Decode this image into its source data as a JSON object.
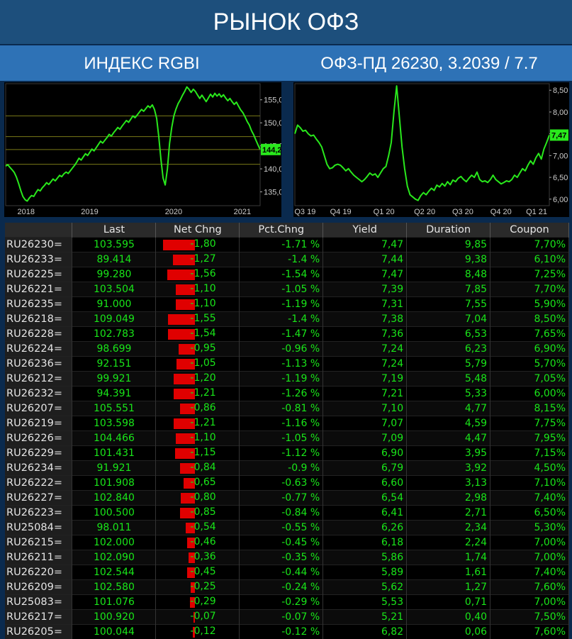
{
  "header": {
    "title": "РЫНОК ОФЗ"
  },
  "subheader": {
    "left": "ИНДЕКС RGBI",
    "right": "ОФЗ-ПД 26230, 3.2039 / 7.7"
  },
  "colors": {
    "line": "#29e81c",
    "bar": "#e00000",
    "text_green": "#19e619",
    "title_bg": "#1d4f7c",
    "sub_bg": "#2e72b6"
  },
  "chart_data": [
    {
      "type": "line",
      "x_labels": [
        "2018",
        "2019",
        "2020",
        "2021"
      ],
      "y_ticks": [
        "155,0",
        "150,0",
        "145,0",
        "140,0",
        "135,0"
      ],
      "ylim": [
        132,
        158.5
      ],
      "last_value_label": "144,2",
      "x": [
        0,
        1,
        2,
        3,
        4,
        5,
        6,
        7,
        8,
        9,
        10,
        11,
        12,
        13,
        14,
        15,
        16,
        17,
        18,
        19,
        20,
        21,
        22,
        23,
        24,
        25,
        26,
        27,
        28,
        29,
        30,
        31,
        32,
        33,
        34,
        35,
        36,
        37,
        38,
        39,
        40,
        41,
        42,
        43,
        44,
        45,
        46,
        47,
        48,
        49,
        50,
        51,
        52,
        53,
        54,
        55,
        56,
        57,
        58,
        59,
        60,
        61,
        62,
        63,
        64,
        65,
        66,
        67,
        68,
        69,
        70,
        71,
        72,
        73,
        74,
        75,
        76,
        77,
        78,
        79,
        80,
        81,
        82,
        83,
        84,
        85,
        86,
        87,
        88,
        89,
        90,
        91,
        92,
        93,
        94,
        95,
        96,
        97,
        98,
        99,
        100,
        101,
        102,
        103,
        104,
        105,
        106,
        107,
        108,
        109,
        110,
        111,
        112,
        113,
        114,
        115,
        116,
        117,
        118,
        119,
        120,
        121,
        122,
        123,
        124,
        125,
        126,
        127,
        128,
        129,
        130,
        131,
        132,
        133,
        134,
        135,
        136,
        137,
        138,
        139,
        140,
        141,
        142,
        143,
        144,
        145,
        146,
        147,
        148,
        149,
        150,
        151,
        152,
        153,
        154,
        155,
        156,
        157,
        158,
        159,
        160,
        161,
        162,
        163,
        164,
        165,
        166,
        167,
        168,
        169,
        170,
        171,
        172,
        173,
        174,
        175,
        176,
        177,
        178,
        179,
        180,
        181,
        182,
        183,
        184,
        185,
        186,
        187,
        188,
        189,
        190,
        191,
        192,
        193,
        194,
        195,
        196,
        197,
        198,
        199,
        200
      ],
      "values": [
        140.6,
        140.9,
        140.3,
        139.8,
        139.2,
        138.2,
        136.8,
        135.3,
        134.0,
        133.3,
        133.0,
        133.7,
        134.2,
        134.0,
        134.8,
        135.5,
        135.2,
        135.9,
        136.4,
        137.0,
        136.6,
        137.2,
        137.8,
        137.4,
        138.0,
        138.6,
        138.3,
        138.9,
        139.3,
        139.0,
        139.6,
        140.2,
        140.8,
        141.5,
        142.3,
        141.9,
        142.6,
        143.3,
        142.9,
        143.6,
        144.3,
        143.9,
        144.6,
        145.3,
        146.0,
        145.6,
        146.2,
        146.8,
        147.5,
        147.1,
        147.8,
        148.4,
        149.0,
        148.6,
        149.3,
        149.9,
        150.5,
        150.1,
        150.8,
        151.5,
        151.1,
        151.7,
        152.3,
        152.9,
        152.5,
        153.1,
        153.7,
        153.3,
        153.9,
        152.9,
        151.0,
        147.0,
        142.0,
        138.0,
        136.5,
        140.0,
        145.5,
        149.0,
        151.5,
        153.0,
        154.2,
        155.0,
        156.0,
        156.8,
        157.8,
        157.3,
        156.6,
        157.3,
        156.8,
        156.0,
        155.3,
        156.0,
        155.3,
        154.6,
        155.4,
        156.2,
        155.6,
        156.4,
        155.8,
        156.3,
        155.6,
        156.1,
        155.4,
        154.8,
        155.3,
        154.6,
        154.0,
        154.5,
        153.6,
        152.8,
        152.2,
        151.3,
        150.3,
        149.5,
        148.3,
        147.4,
        146.3,
        145.2,
        144.2
      ]
    },
    {
      "type": "line",
      "x_labels": [
        "Q3 19",
        "Q4 19",
        "Q1 20",
        "Q2 20",
        "Q3 20",
        "Q4 20",
        "Q1 21"
      ],
      "y_ticks": [
        "8,50",
        "8,00",
        "7,50",
        "7,00",
        "6,50",
        "6,00"
      ],
      "ylim": [
        5.85,
        8.65
      ],
      "last_value_label": "7,47",
      "values": [
        7.5,
        7.7,
        7.64,
        7.56,
        7.58,
        7.5,
        7.45,
        7.47,
        7.38,
        7.3,
        7.2,
        7.0,
        6.8,
        6.7,
        6.72,
        6.78,
        6.8,
        6.78,
        6.72,
        6.65,
        6.7,
        6.62,
        6.55,
        6.5,
        6.45,
        6.4,
        6.45,
        6.52,
        6.6,
        6.55,
        6.58,
        6.5,
        6.6,
        6.7,
        6.75,
        7.0,
        7.3,
        8.0,
        8.6,
        7.9,
        7.2,
        6.7,
        6.3,
        6.1,
        6.05,
        6.0,
        5.97,
        6.08,
        6.15,
        6.1,
        6.18,
        6.25,
        6.2,
        6.32,
        6.28,
        6.36,
        6.3,
        6.4,
        6.33,
        6.44,
        6.4,
        6.48,
        6.52,
        6.45,
        6.4,
        6.48,
        6.55,
        6.5,
        6.62,
        6.45,
        6.4,
        6.42,
        6.38,
        6.45,
        6.55,
        6.45,
        6.4,
        6.35,
        6.38,
        6.42,
        6.4,
        6.45,
        6.55,
        6.5,
        6.6,
        6.7,
        6.65,
        6.78,
        6.88,
        6.8,
        6.95,
        7.05,
        6.92,
        7.15,
        7.3,
        7.47
      ]
    },
    {
      "type": "table",
      "columns": [
        "",
        "Last",
        "Net Chng",
        "Pct.Chng",
        "Yield",
        "Duration",
        "Coupon"
      ],
      "rows": [
        {
          "ric": "RU26230=",
          "last": "103.595",
          "chg": "-1,80",
          "chg_value": -1.8,
          "pct": "-1.71 %",
          "yield": "7,47",
          "duration": "9,85",
          "coupon": "7,70%"
        },
        {
          "ric": "RU26233=",
          "last": "89.414",
          "chg": "-1,27",
          "chg_value": -1.27,
          "pct": "-1.4 %",
          "yield": "7,44",
          "duration": "9,38",
          "coupon": "6,10%"
        },
        {
          "ric": "RU26225=",
          "last": "99.280",
          "chg": "-1,56",
          "chg_value": -1.56,
          "pct": "-1.54 %",
          "yield": "7,47",
          "duration": "8,48",
          "coupon": "7,25%"
        },
        {
          "ric": "RU26221=",
          "last": "103.504",
          "chg": "-1,10",
          "chg_value": -1.1,
          "pct": "-1.05 %",
          "yield": "7,39",
          "duration": "7,85",
          "coupon": "7,70%"
        },
        {
          "ric": "RU26235=",
          "last": "91.000",
          "chg": "-1,10",
          "chg_value": -1.1,
          "pct": "-1.19 %",
          "yield": "7,31",
          "duration": "7,55",
          "coupon": "5,90%"
        },
        {
          "ric": "RU26218=",
          "last": "109.049",
          "chg": "-1,55",
          "chg_value": -1.55,
          "pct": "-1.4 %",
          "yield": "7,38",
          "duration": "7,04",
          "coupon": "8,50%"
        },
        {
          "ric": "RU26228=",
          "last": "102.783",
          "chg": "-1,54",
          "chg_value": -1.54,
          "pct": "-1.47 %",
          "yield": "7,36",
          "duration": "6,53",
          "coupon": "7,65%"
        },
        {
          "ric": "RU26224=",
          "last": "98.699",
          "chg": "-0,95",
          "chg_value": -0.95,
          "pct": "-0.96 %",
          "yield": "7,24",
          "duration": "6,23",
          "coupon": "6,90%"
        },
        {
          "ric": "RU26236=",
          "last": "92.151",
          "chg": "-1,05",
          "chg_value": -1.05,
          "pct": "-1.13 %",
          "yield": "7,24",
          "duration": "5,79",
          "coupon": "5,70%"
        },
        {
          "ric": "RU26212=",
          "last": "99.921",
          "chg": "-1,20",
          "chg_value": -1.2,
          "pct": "-1.19 %",
          "yield": "7,19",
          "duration": "5,48",
          "coupon": "7,05%"
        },
        {
          "ric": "RU26232=",
          "last": "94.391",
          "chg": "-1,21",
          "chg_value": -1.21,
          "pct": "-1.26 %",
          "yield": "7,21",
          "duration": "5,33",
          "coupon": "6,00%"
        },
        {
          "ric": "RU26207=",
          "last": "105.551",
          "chg": "-0,86",
          "chg_value": -0.86,
          "pct": "-0.81 %",
          "yield": "7,10",
          "duration": "4,77",
          "coupon": "8,15%"
        },
        {
          "ric": "RU26219=",
          "last": "103.598",
          "chg": "-1,21",
          "chg_value": -1.21,
          "pct": "-1.16 %",
          "yield": "7,07",
          "duration": "4,59",
          "coupon": "7,75%"
        },
        {
          "ric": "RU26226=",
          "last": "104.466",
          "chg": "-1,10",
          "chg_value": -1.1,
          "pct": "-1.05 %",
          "yield": "7,09",
          "duration": "4,47",
          "coupon": "7,95%"
        },
        {
          "ric": "RU26229=",
          "last": "101.431",
          "chg": "-1,15",
          "chg_value": -1.15,
          "pct": "-1.12 %",
          "yield": "6,90",
          "duration": "3,95",
          "coupon": "7,15%"
        },
        {
          "ric": "RU26234=",
          "last": "91.921",
          "chg": "-0,84",
          "chg_value": -0.84,
          "pct": "-0.9 %",
          "yield": "6,79",
          "duration": "3,92",
          "coupon": "4,50%"
        },
        {
          "ric": "RU26222=",
          "last": "101.908",
          "chg": "-0,65",
          "chg_value": -0.65,
          "pct": "-0.63 %",
          "yield": "6,60",
          "duration": "3,13",
          "coupon": "7,10%"
        },
        {
          "ric": "RU26227=",
          "last": "102.840",
          "chg": "-0,80",
          "chg_value": -0.8,
          "pct": "-0.77 %",
          "yield": "6,54",
          "duration": "2,98",
          "coupon": "7,40%"
        },
        {
          "ric": "RU26223=",
          "last": "100.500",
          "chg": "-0,85",
          "chg_value": -0.85,
          "pct": "-0.84 %",
          "yield": "6,41",
          "duration": "2,71",
          "coupon": "6,50%"
        },
        {
          "ric": "RU25084=",
          "last": "98.011",
          "chg": "-0,54",
          "chg_value": -0.54,
          "pct": "-0.55 %",
          "yield": "6,26",
          "duration": "2,34",
          "coupon": "5,30%"
        },
        {
          "ric": "RU26215=",
          "last": "102.000",
          "chg": "-0,46",
          "chg_value": -0.46,
          "pct": "-0.45 %",
          "yield": "6,18",
          "duration": "2,24",
          "coupon": "7,00%"
        },
        {
          "ric": "RU26211=",
          "last": "102.090",
          "chg": "-0,36",
          "chg_value": -0.36,
          "pct": "-0.35 %",
          "yield": "5,86",
          "duration": "1,74",
          "coupon": "7,00%"
        },
        {
          "ric": "RU26220=",
          "last": "102.544",
          "chg": "-0,45",
          "chg_value": -0.45,
          "pct": "-0.44 %",
          "yield": "5,89",
          "duration": "1,61",
          "coupon": "7,40%"
        },
        {
          "ric": "RU26209=",
          "last": "102.580",
          "chg": "-0,25",
          "chg_value": -0.25,
          "pct": "-0.24 %",
          "yield": "5,62",
          "duration": "1,27",
          "coupon": "7,60%"
        },
        {
          "ric": "RU25083=",
          "last": "101.076",
          "chg": "-0,29",
          "chg_value": -0.29,
          "pct": "-0.29 %",
          "yield": "5,53",
          "duration": "0,71",
          "coupon": "7,00%"
        },
        {
          "ric": "RU26217=",
          "last": "100.920",
          "chg": "-0,07",
          "chg_value": -0.07,
          "pct": "-0.07 %",
          "yield": "5,21",
          "duration": "0,40",
          "coupon": "7,50%"
        },
        {
          "ric": "RU26205=",
          "last": "100.044",
          "chg": "-0,12",
          "chg_value": -0.12,
          "pct": "-0.12 %",
          "yield": "6,82",
          "duration": "0,06",
          "coupon": "7,60%"
        }
      ]
    }
  ]
}
